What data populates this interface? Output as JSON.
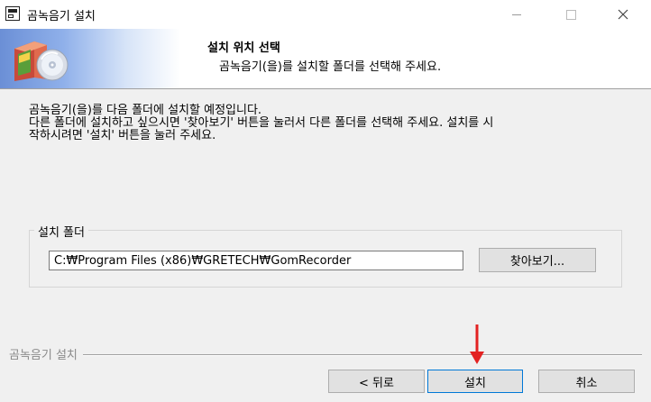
{
  "window": {
    "title": "곰녹음기 설치",
    "icon": "installer-app-icon"
  },
  "header": {
    "title": "설치 위치 선택",
    "subtitle": "곰녹음기(을)를 설치할 폴더를 선택해 주세요.",
    "graphic_icon": "software-box-cd-icon"
  },
  "description": {
    "line1": "곰녹음기(을)를 다음 폴더에 설치할 예정입니다.",
    "line2": "다른 폴더에 설치하고 싶으시면 '찾아보기' 버튼을 눌러서 다른 폴더를 선택해 주세요. 설치를 시",
    "line3": "작하시려면 '설치' 버튼을 눌러 주세요."
  },
  "install_folder": {
    "group_label": "설치 폴더",
    "path_value": "C:₩Program Files (x86)₩GRETECH₩GomRecorder",
    "browse_label": "찾아보기..."
  },
  "footer": {
    "brand": "곰녹음기 설치",
    "back_label": "< 뒤로",
    "install_label": "설치",
    "cancel_label": "취소"
  },
  "colors": {
    "accent_arrow": "#e32222",
    "focus_border": "#0078d7",
    "header_gradient_start": "#6b8fd6"
  }
}
